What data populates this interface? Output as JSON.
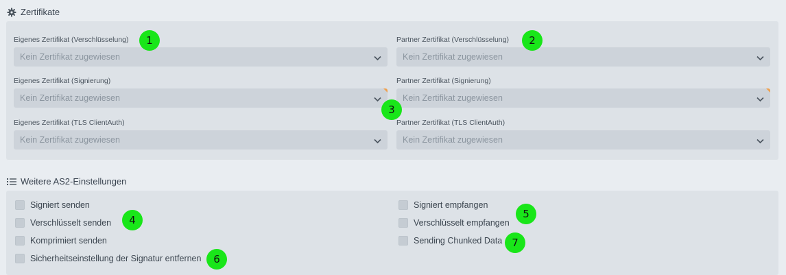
{
  "certificates": {
    "title": "Zertifikate",
    "icon": "gear-icon",
    "fields": [
      {
        "label": "Eigenes Zertifikat (Verschlüsselung)",
        "value": "Kein Zertifikat zugewiesen"
      },
      {
        "label": "Partner Zertifikat (Verschlüsselung)",
        "value": "Kein Zertifikat zugewiesen"
      },
      {
        "label": "Eigenes Zertifikat (Signierung)",
        "value": "Kein Zertifikat zugewiesen"
      },
      {
        "label": "Partner Zertifikat (Signierung)",
        "value": "Kein Zertifikat zugewiesen"
      },
      {
        "label": "Eigenes Zertifikat (TLS ClientAuth)",
        "value": "Kein Zertifikat zugewiesen"
      },
      {
        "label": "Partner Zertifikat (TLS ClientAuth)",
        "value": "Kein Zertifikat zugewiesen"
      }
    ]
  },
  "as2": {
    "title": "Weitere AS2-Einstellungen",
    "icon": "list-icon",
    "options": [
      {
        "label": "Signiert senden",
        "checked": false
      },
      {
        "label": "Verschlüsselt senden",
        "checked": false
      },
      {
        "label": "Komprimiert senden",
        "checked": false
      },
      {
        "label": "Sicherheitseinstellung der Signatur entfernen",
        "checked": false
      },
      {
        "label": "Signiert empfangen",
        "checked": false
      },
      {
        "label": "Verschlüsselt empfangen",
        "checked": false
      },
      {
        "label": "Sending Chunked Data",
        "checked": false
      }
    ]
  },
  "markers": [
    "1",
    "2",
    "3",
    "4",
    "5",
    "6",
    "7"
  ],
  "colors": {
    "marker": "#19e619",
    "panel": "#dde2e7",
    "select": "#cdd3da",
    "required_corner": "#f0a04b"
  }
}
